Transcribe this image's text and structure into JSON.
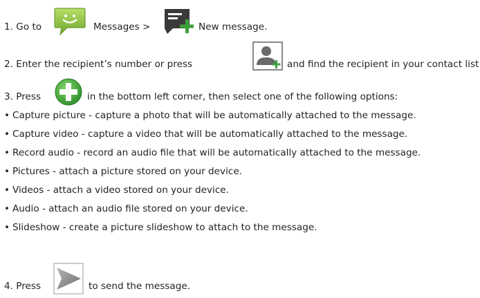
{
  "steps": {
    "step1": {
      "a": "1. Go to",
      "b": "Messages >",
      "c": "New message."
    },
    "step2": {
      "a": "2. Enter the recipient’s number or press",
      "b": "and find the recipient in your contact list."
    },
    "step3": {
      "a": "3. Press",
      "b": "in the bottom left corner, then select one of the following options:"
    },
    "step4": {
      "a": "4. Press",
      "b": "to send the message."
    }
  },
  "bullet_glyph": "•",
  "options": [
    "Capture picture - capture a photo that will be automatically attached to the message.",
    "Capture video - capture a video that will be automatically attached to the message.",
    "Record audio - record an audio file that will be automatically attached to the message.",
    "Pictures - attach a picture stored on your device.",
    "Videos - attach a video stored on your device.",
    "Audio - attach an audio file stored on your device.",
    "Slideshow - create a picture slideshow to attach to the message."
  ],
  "icons": {
    "messages": "messages-app-icon",
    "new_message": "new-message-icon",
    "add_contact": "add-contact-icon",
    "attach": "attach-plus-icon",
    "send": "send-icon"
  },
  "colors": {
    "text": "#231f20",
    "messages_green": "#8bc13f",
    "attach_green": "#3aa935",
    "icon_dark": "#3a3a3a",
    "plus_green": "#3da13a",
    "send_gray": "#8a8a8a"
  }
}
